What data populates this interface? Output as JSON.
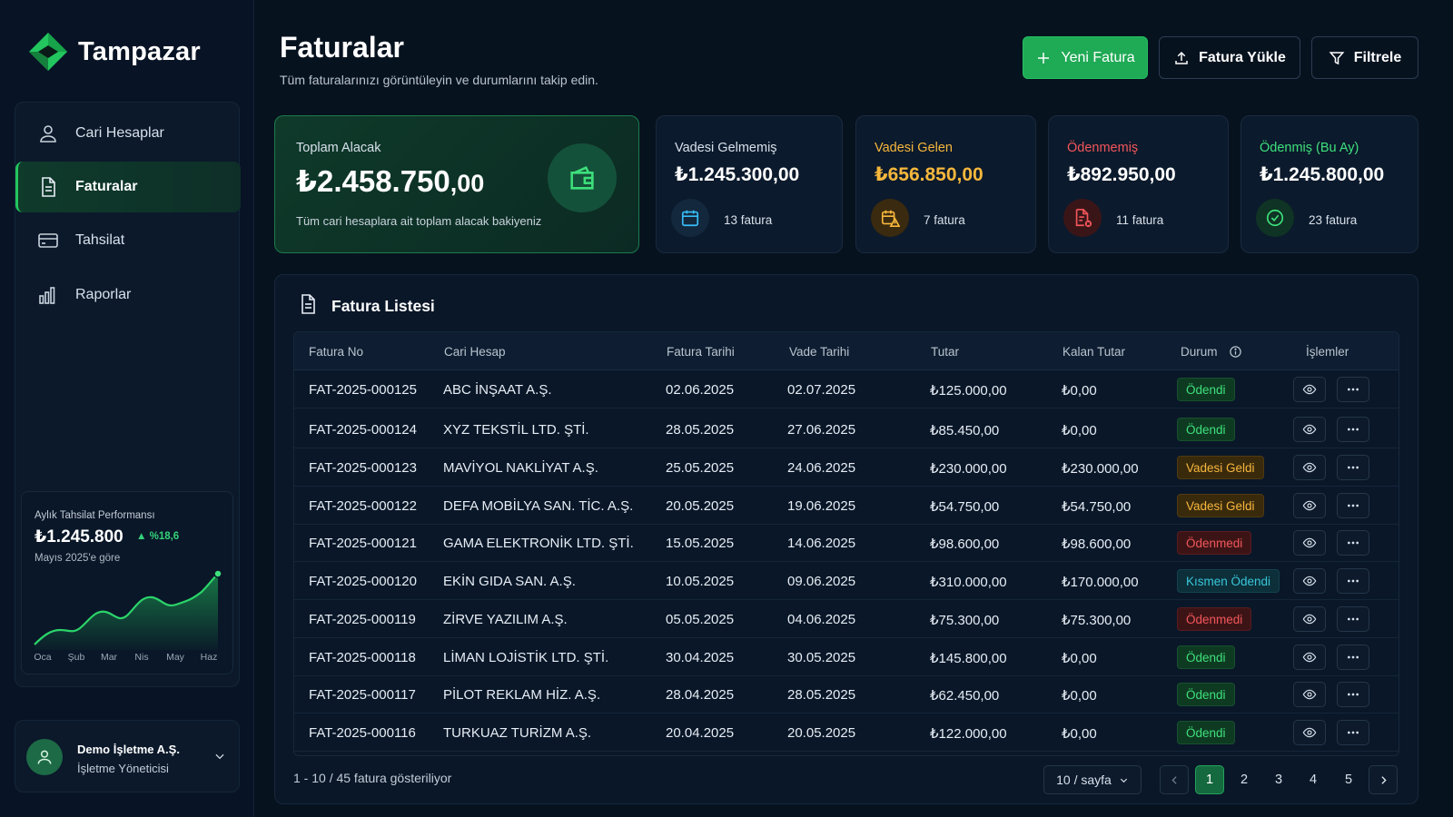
{
  "brand": {
    "name": "Tampazar"
  },
  "sidebar": {
    "items": [
      {
        "label": "Cari Hesaplar",
        "icon": "user-icon"
      },
      {
        "label": "Faturalar",
        "icon": "document-icon",
        "active": true
      },
      {
        "label": "Tahsilat",
        "icon": "card-icon"
      },
      {
        "label": "Raporlar",
        "icon": "bar-chart-icon"
      }
    ],
    "performance": {
      "title": "Aylık Tahsilat Performansı",
      "value": "₺1.245.800",
      "change": "%18,6",
      "subtitle": "Mayıs 2025'e göre",
      "months": [
        "Oca",
        "Şub",
        "Mar",
        "Nis",
        "May",
        "Haz"
      ]
    },
    "user": {
      "name": "Demo İşletme A.Ş.",
      "role": "İşletme Yöneticisi"
    }
  },
  "header": {
    "title": "Faturalar",
    "subtitle": "Tüm faturalarınızı görüntüleyin ve durumlarını takip edin.",
    "new_label": "Yeni Fatura",
    "upload_label": "Fatura Yükle",
    "filter_label": "Filtrele"
  },
  "stats": {
    "total": {
      "label": "Toplam Alacak",
      "value_main": "₺2.458.750",
      "value_dec": ",00",
      "desc": "Tüm cari hesaplara ait toplam alacak bakiyeniz"
    },
    "cards": [
      {
        "label": "Vadesi Gelmemiş",
        "value": "₺1.245.300,00",
        "count": "13 fatura",
        "color": "#d7e0ea"
      },
      {
        "label": "Vadesi Gelen",
        "value": "₺656.850,00",
        "count": "7 fatura",
        "color": "#f6b73c"
      },
      {
        "label": "Ödenmemiş",
        "value": "₺892.950,00",
        "count": "11 fatura",
        "color": "#f2565a"
      },
      {
        "label": "Ödenmiş (Bu Ay)",
        "value": "₺1.245.800,00",
        "count": "23 fatura",
        "color": "#3ee07b"
      }
    ]
  },
  "table": {
    "title": "Fatura Listesi",
    "columns": [
      "Fatura No",
      "Cari Hesap",
      "Fatura Tarihi",
      "Vade Tarihi",
      "Tutar",
      "Kalan Tutar",
      "Durum",
      "İşlemler"
    ],
    "rows": [
      {
        "no": "FAT-2025-000125",
        "account": "ABC İNŞAAT A.Ş.",
        "date": "02.06.2025",
        "due": "02.07.2025",
        "amount": "₺125.000,00",
        "remaining": "₺0,00",
        "status": "Ödendi",
        "kind": "paid"
      },
      {
        "no": "FAT-2025-000124",
        "account": "XYZ TEKSTİL LTD. ŞTİ.",
        "date": "28.05.2025",
        "due": "27.06.2025",
        "amount": "₺85.450,00",
        "remaining": "₺0,00",
        "status": "Ödendi",
        "kind": "paid"
      },
      {
        "no": "FAT-2025-000123",
        "account": "MAVİYOL NAKLİYAT A.Ş.",
        "date": "25.05.2025",
        "due": "24.06.2025",
        "amount": "₺230.000,00",
        "remaining": "₺230.000,00",
        "status": "Vadesi Geldi",
        "kind": "due"
      },
      {
        "no": "FAT-2025-000122",
        "account": "DEFA MOBİLYA SAN. TİC. A.Ş.",
        "date": "20.05.2025",
        "due": "19.06.2025",
        "amount": "₺54.750,00",
        "remaining": "₺54.750,00",
        "status": "Vadesi Geldi",
        "kind": "due"
      },
      {
        "no": "FAT-2025-000121",
        "account": "GAMA ELEKTRONİK LTD. ŞTİ.",
        "date": "15.05.2025",
        "due": "14.06.2025",
        "amount": "₺98.600,00",
        "remaining": "₺98.600,00",
        "status": "Ödenmedi",
        "kind": "unpaid"
      },
      {
        "no": "FAT-2025-000120",
        "account": "EKİN GIDA SAN. A.Ş.",
        "date": "10.05.2025",
        "due": "09.06.2025",
        "amount": "₺310.000,00",
        "remaining": "₺170.000,00",
        "status": "Kısmen Ödendi",
        "kind": "partial"
      },
      {
        "no": "FAT-2025-000119",
        "account": "ZİRVE YAZILIM A.Ş.",
        "date": "05.05.2025",
        "due": "04.06.2025",
        "amount": "₺75.300,00",
        "remaining": "₺75.300,00",
        "status": "Ödenmedi",
        "kind": "unpaid"
      },
      {
        "no": "FAT-2025-000118",
        "account": "LİMAN LOJİSTİK LTD. ŞTİ.",
        "date": "30.04.2025",
        "due": "30.05.2025",
        "amount": "₺145.800,00",
        "remaining": "₺0,00",
        "status": "Ödendi",
        "kind": "paid"
      },
      {
        "no": "FAT-2025-000117",
        "account": "PİLOT REKLAM HİZ. A.Ş.",
        "date": "28.04.2025",
        "due": "28.05.2025",
        "amount": "₺62.450,00",
        "remaining": "₺0,00",
        "status": "Ödendi",
        "kind": "paid"
      },
      {
        "no": "FAT-2025-000116",
        "account": "TURKUAZ TURİZM A.Ş.",
        "date": "20.04.2025",
        "due": "20.05.2025",
        "amount": "₺122.000,00",
        "remaining": "₺0,00",
        "status": "Ödendi",
        "kind": "paid"
      }
    ],
    "footer": "1 - 10 / 45 fatura gösteriliyor",
    "per_page": "10 / sayfa",
    "pages": [
      "1",
      "2",
      "3",
      "4",
      "5"
    ],
    "current_page": "1"
  },
  "colors": {
    "accent": "#22c55e",
    "warning": "#f6b73c",
    "danger": "#f2565a",
    "info": "#39c7d9"
  }
}
